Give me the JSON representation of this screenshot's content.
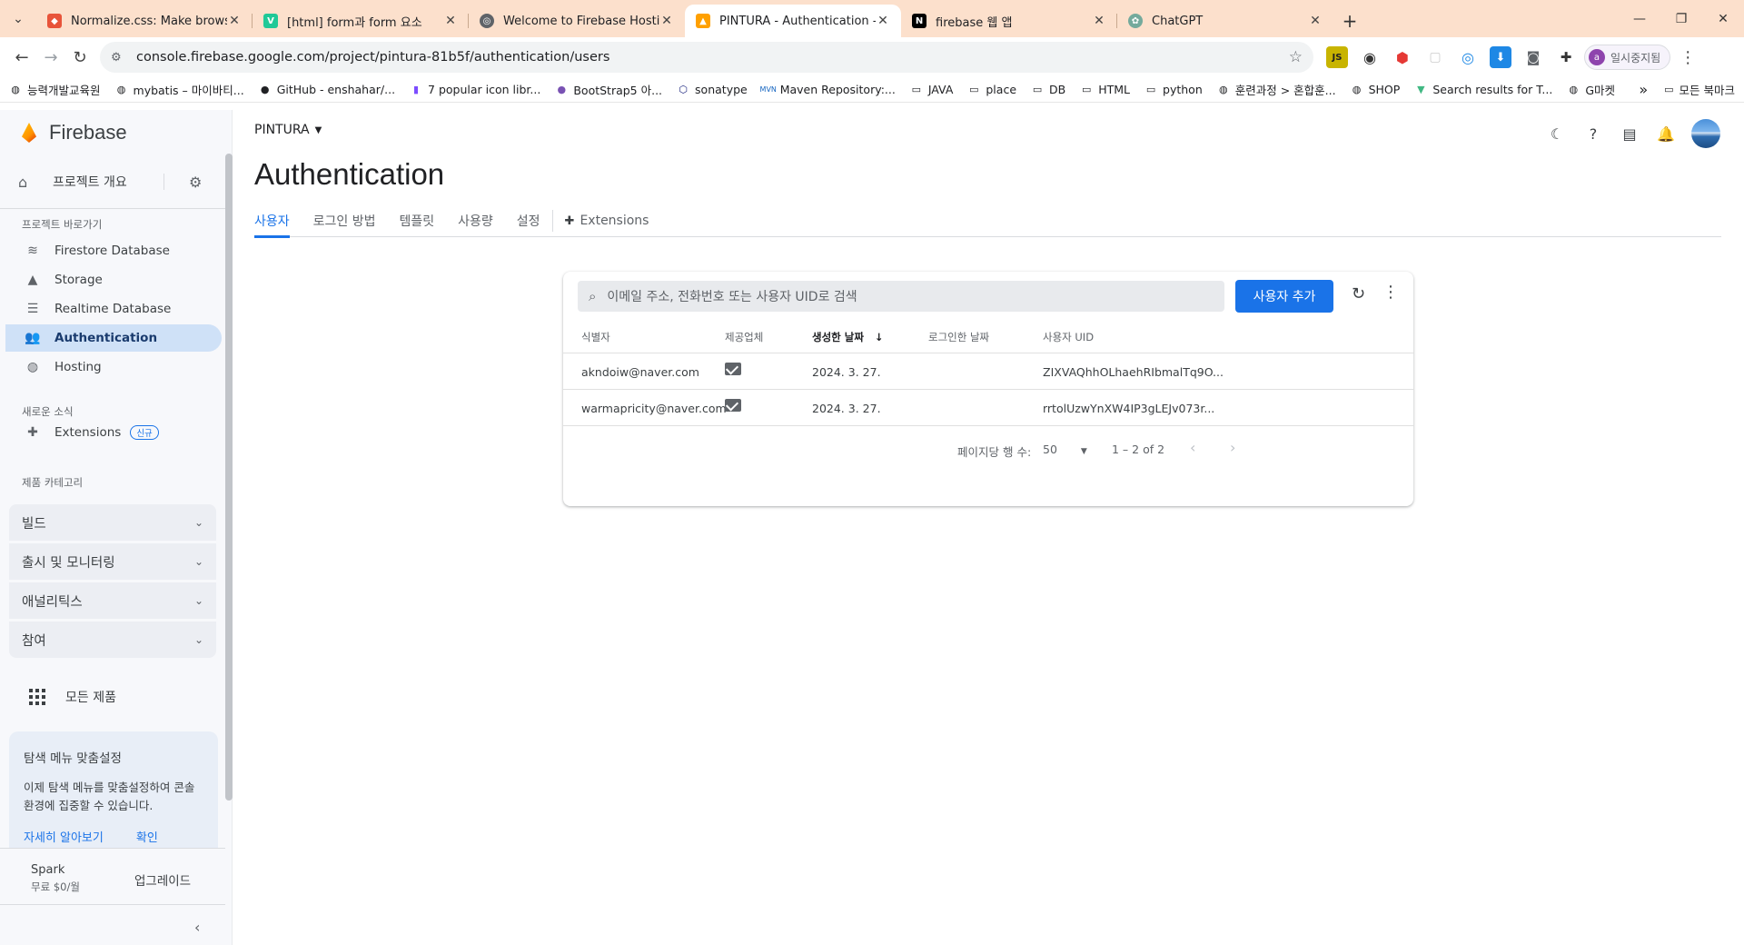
{
  "browser": {
    "tabs": [
      {
        "title": "Normalize.css: Make browsers",
        "favicon_color": "#e8543a"
      },
      {
        "title": "[html] form과 form 요소",
        "favicon_color": "#20c997"
      },
      {
        "title": "Welcome to Firebase Hosting",
        "favicon_color": "#5f6368"
      },
      {
        "title": "PINTURA - Authentication - Fi",
        "favicon_color": "#ffa000"
      },
      {
        "title": "firebase 웹 앱",
        "favicon_color": "#000000"
      },
      {
        "title": "ChatGPT",
        "favicon_color": "#74aa9c"
      }
    ],
    "url": "console.firebase.google.com/project/pintura-81b5f/authentication/users",
    "profile_label": "일시중지됨",
    "profile_initial": "a",
    "bookmarks": [
      "능력개발교육원",
      "mybatis – 마이바티...",
      "GitHub - enshahar/...",
      "7 popular icon libr...",
      "BootStrap5 아...",
      "sonatype",
      "Maven Repository:...",
      "JAVA",
      "place",
      "DB",
      "HTML",
      "python",
      "훈련과정 > 혼합훈...",
      "SHOP",
      "Search results for T...",
      "G마켓"
    ],
    "bookmarks_more": "모든 북마크"
  },
  "sidebar": {
    "brand": "Firebase",
    "overview": "프로젝트 개요",
    "shortcuts_label": "프로젝트 바로가기",
    "shortcuts": [
      "Firestore Database",
      "Storage",
      "Realtime Database",
      "Authentication",
      "Hosting"
    ],
    "news_label": "새로운 소식",
    "extensions": "Extensions",
    "extensions_badge": "신규",
    "category_label": "제품 카테고리",
    "categories": [
      "빌드",
      "출시 및 모니터링",
      "애널리틱스",
      "참여"
    ],
    "all_products": "모든 제품",
    "tip": {
      "title": "탐색 메뉴 맞춤설정",
      "body": "이제 탐색 메뉴를 맞춤설정하여 콘솔 환경에 집중할 수 있습니다.",
      "learn_more": "자세히 알아보기",
      "ok": "확인"
    },
    "plan": {
      "name": "Spark",
      "price": "무료 $0/월",
      "upgrade": "업그레이드"
    }
  },
  "header": {
    "project": "PINTURA",
    "title": "Authentication",
    "tabs": [
      "사용자",
      "로그인 방법",
      "템플릿",
      "사용량",
      "설정"
    ],
    "extensions_tab": "Extensions"
  },
  "users": {
    "search_placeholder": "이메일 주소, 전화번호 또는 사용자 UID로 검색",
    "add_button": "사용자 추가",
    "columns": [
      "식별자",
      "제공업체",
      "생성한 날짜",
      "로그인한 날짜",
      "사용자 UID"
    ],
    "rows": [
      {
        "identifier": "akndoiw@naver.com",
        "provider": "email",
        "created": "2024. 3. 27.",
        "signed_in": "",
        "uid": "ZIXVAQhhOLhaehRIbmalTq9O..."
      },
      {
        "identifier": "warmapricity@naver.com",
        "provider": "email",
        "created": "2024. 3. 27.",
        "signed_in": "",
        "uid": "rrtolUzwYnXW4IP3gLEJv073r..."
      }
    ],
    "rows_per_page_label": "페이지당 행 수:",
    "rows_per_page": "50",
    "range": "1 – 2 of 2"
  },
  "colors": {
    "accent": "#1a73e8",
    "tabstrip": "#fce0cc",
    "active_nav": "#cfe1f7"
  }
}
